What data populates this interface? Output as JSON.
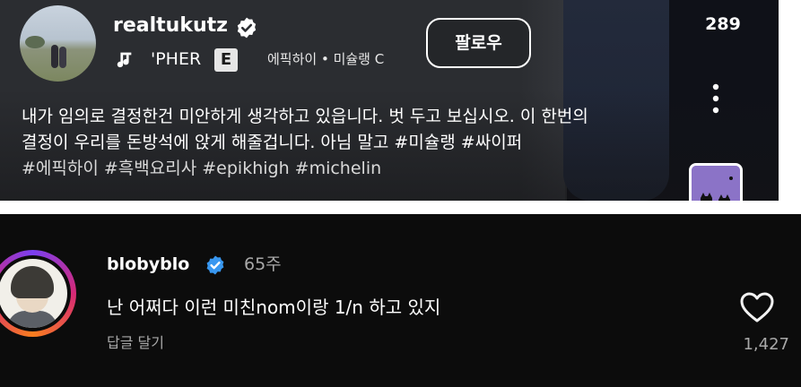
{
  "post": {
    "username": "realtukutz",
    "follow_label": "팔로우",
    "like_count": "289",
    "music": {
      "title": "'PHER",
      "explicit_label": "E",
      "subtitle": "에픽하이 • 미슐랭 C"
    },
    "caption_line1": "내가 임의로 결정한건 미안하게 생각하고 있읍니다. 벗 두고 보십시오. 이 한번의",
    "caption_line2": "결정이 우리를 돈방석에 앉게 해줄겁니다. 아님 말고 #미슐랭 #싸이퍼",
    "caption_line3": "#에픽하이 #흑백요리사 #epikhigh #michelin"
  },
  "comment": {
    "username": "blobyblo",
    "time": "65주",
    "text": "난 어쩌다 이런 미친nom이랑 1/n 하고 있지",
    "reply_label": "답글 달기",
    "like_count": "1,427"
  },
  "icons": {
    "verified": "verified-badge-icon",
    "music": "music-note-icon",
    "more": "more-vertical-icon",
    "heart": "heart-outline-icon"
  },
  "colors": {
    "post_bg": "#2b2d31",
    "comment_bg": "#0c0c0c",
    "verified_blue": "#3897f0",
    "muted_text": "#a8a8a8"
  }
}
